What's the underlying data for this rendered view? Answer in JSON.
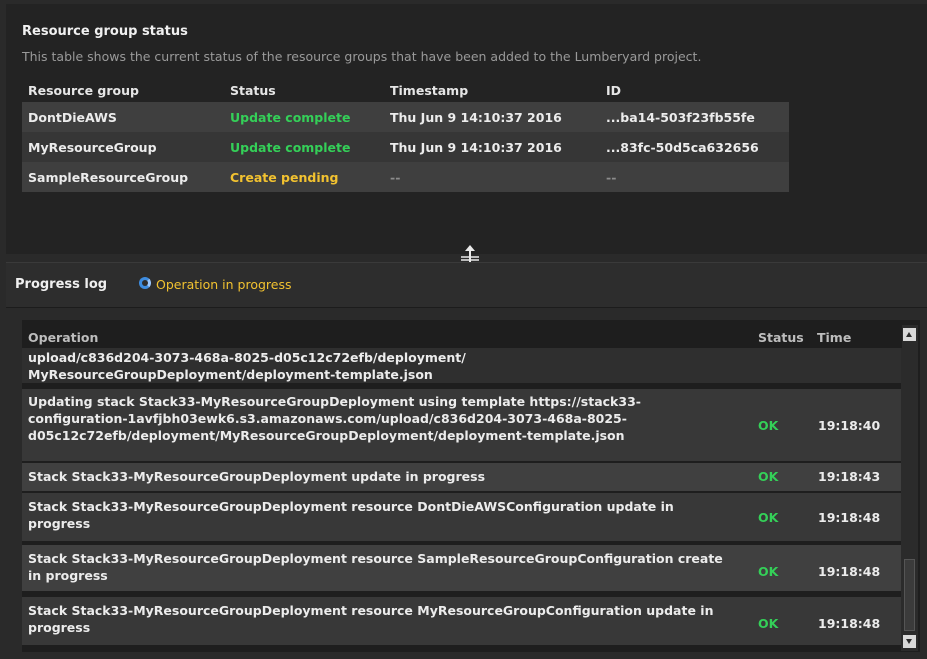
{
  "resource_panel": {
    "title": "Resource group status",
    "description": "This table shows the current status of the resource groups that have been added to the Lumberyard project.",
    "columns": [
      "Resource group",
      "Status",
      "Timestamp",
      "ID"
    ],
    "rows": [
      {
        "name": "DontDieAWS",
        "status": "Update complete",
        "timestamp": "Thu Jun 9 14:10:37 2016",
        "id": "...ba14-503f23fb55fe"
      },
      {
        "name": "MyResourceGroup",
        "status": "Update complete",
        "timestamp": "Thu Jun 9 14:10:37 2016",
        "id": "...83fc-50d5ca632656"
      },
      {
        "name": "SampleResourceGroup",
        "status": "Create pending",
        "timestamp": "--",
        "id": "--"
      }
    ]
  },
  "progress": {
    "title": "Progress log",
    "status": "Operation in progress"
  },
  "log": {
    "columns": {
      "operation": "Operation",
      "status": "Status",
      "time": "Time"
    },
    "rows": [
      {
        "operation": "upload/c836d204-3073-468a-8025-d05c12c72efb/deployment/ MyResourceGroupDeployment/deployment-template.json",
        "status": "",
        "time": ""
      },
      {
        "operation": "Updating stack Stack33-MyResourceGroupDeployment using template https://stack33-configuration-1avfjbh03ewk6.s3.amazonaws.com/upload/c836d204-3073-468a-8025-d05c12c72efb/deployment/MyResourceGroupDeployment/deployment-template.json",
        "status": "OK",
        "time": "19:18:40"
      },
      {
        "operation": "Stack Stack33-MyResourceGroupDeployment update in progress",
        "status": "OK",
        "time": "19:18:43"
      },
      {
        "operation": "Stack Stack33-MyResourceGroupDeployment resource DontDieAWSConfiguration update in progress",
        "status": "OK",
        "time": "19:18:48"
      },
      {
        "operation": "Stack Stack33-MyResourceGroupDeployment resource SampleResourceGroupConfiguration create in progress",
        "status": "OK",
        "time": "19:18:48"
      },
      {
        "operation": "Stack Stack33-MyResourceGroupDeployment resource MyResourceGroupConfiguration update in progress",
        "status": "OK",
        "time": "19:18:48"
      }
    ]
  },
  "colors": {
    "ok_green": "#34d058",
    "pending_yellow": "#f2c230",
    "spinner_blue": "#3d8ce0"
  },
  "icons": [
    "resize-vertical-icon",
    "spinner-icon",
    "scroll-up-icon",
    "scroll-down-icon"
  ]
}
